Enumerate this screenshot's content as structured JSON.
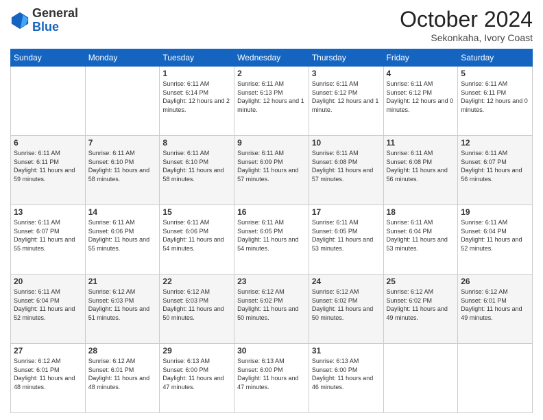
{
  "header": {
    "logo": {
      "line1": "General",
      "line2": "Blue"
    },
    "title": "October 2024",
    "subtitle": "Sekonkaha, Ivory Coast"
  },
  "days_of_week": [
    "Sunday",
    "Monday",
    "Tuesday",
    "Wednesday",
    "Thursday",
    "Friday",
    "Saturday"
  ],
  "weeks": [
    [
      {
        "day": "",
        "info": ""
      },
      {
        "day": "",
        "info": ""
      },
      {
        "day": "1",
        "sunrise": "Sunrise: 6:11 AM",
        "sunset": "Sunset: 6:14 PM",
        "daylight": "Daylight: 12 hours and 2 minutes."
      },
      {
        "day": "2",
        "sunrise": "Sunrise: 6:11 AM",
        "sunset": "Sunset: 6:13 PM",
        "daylight": "Daylight: 12 hours and 1 minute."
      },
      {
        "day": "3",
        "sunrise": "Sunrise: 6:11 AM",
        "sunset": "Sunset: 6:12 PM",
        "daylight": "Daylight: 12 hours and 1 minute."
      },
      {
        "day": "4",
        "sunrise": "Sunrise: 6:11 AM",
        "sunset": "Sunset: 6:12 PM",
        "daylight": "Daylight: 12 hours and 0 minutes."
      },
      {
        "day": "5",
        "sunrise": "Sunrise: 6:11 AM",
        "sunset": "Sunset: 6:11 PM",
        "daylight": "Daylight: 12 hours and 0 minutes."
      }
    ],
    [
      {
        "day": "6",
        "sunrise": "Sunrise: 6:11 AM",
        "sunset": "Sunset: 6:11 PM",
        "daylight": "Daylight: 11 hours and 59 minutes."
      },
      {
        "day": "7",
        "sunrise": "Sunrise: 6:11 AM",
        "sunset": "Sunset: 6:10 PM",
        "daylight": "Daylight: 11 hours and 58 minutes."
      },
      {
        "day": "8",
        "sunrise": "Sunrise: 6:11 AM",
        "sunset": "Sunset: 6:10 PM",
        "daylight": "Daylight: 11 hours and 58 minutes."
      },
      {
        "day": "9",
        "sunrise": "Sunrise: 6:11 AM",
        "sunset": "Sunset: 6:09 PM",
        "daylight": "Daylight: 11 hours and 57 minutes."
      },
      {
        "day": "10",
        "sunrise": "Sunrise: 6:11 AM",
        "sunset": "Sunset: 6:08 PM",
        "daylight": "Daylight: 11 hours and 57 minutes."
      },
      {
        "day": "11",
        "sunrise": "Sunrise: 6:11 AM",
        "sunset": "Sunset: 6:08 PM",
        "daylight": "Daylight: 11 hours and 56 minutes."
      },
      {
        "day": "12",
        "sunrise": "Sunrise: 6:11 AM",
        "sunset": "Sunset: 6:07 PM",
        "daylight": "Daylight: 11 hours and 56 minutes."
      }
    ],
    [
      {
        "day": "13",
        "sunrise": "Sunrise: 6:11 AM",
        "sunset": "Sunset: 6:07 PM",
        "daylight": "Daylight: 11 hours and 55 minutes."
      },
      {
        "day": "14",
        "sunrise": "Sunrise: 6:11 AM",
        "sunset": "Sunset: 6:06 PM",
        "daylight": "Daylight: 11 hours and 55 minutes."
      },
      {
        "day": "15",
        "sunrise": "Sunrise: 6:11 AM",
        "sunset": "Sunset: 6:06 PM",
        "daylight": "Daylight: 11 hours and 54 minutes."
      },
      {
        "day": "16",
        "sunrise": "Sunrise: 6:11 AM",
        "sunset": "Sunset: 6:05 PM",
        "daylight": "Daylight: 11 hours and 54 minutes."
      },
      {
        "day": "17",
        "sunrise": "Sunrise: 6:11 AM",
        "sunset": "Sunset: 6:05 PM",
        "daylight": "Daylight: 11 hours and 53 minutes."
      },
      {
        "day": "18",
        "sunrise": "Sunrise: 6:11 AM",
        "sunset": "Sunset: 6:04 PM",
        "daylight": "Daylight: 11 hours and 53 minutes."
      },
      {
        "day": "19",
        "sunrise": "Sunrise: 6:11 AM",
        "sunset": "Sunset: 6:04 PM",
        "daylight": "Daylight: 11 hours and 52 minutes."
      }
    ],
    [
      {
        "day": "20",
        "sunrise": "Sunrise: 6:11 AM",
        "sunset": "Sunset: 6:04 PM",
        "daylight": "Daylight: 11 hours and 52 minutes."
      },
      {
        "day": "21",
        "sunrise": "Sunrise: 6:12 AM",
        "sunset": "Sunset: 6:03 PM",
        "daylight": "Daylight: 11 hours and 51 minutes."
      },
      {
        "day": "22",
        "sunrise": "Sunrise: 6:12 AM",
        "sunset": "Sunset: 6:03 PM",
        "daylight": "Daylight: 11 hours and 50 minutes."
      },
      {
        "day": "23",
        "sunrise": "Sunrise: 6:12 AM",
        "sunset": "Sunset: 6:02 PM",
        "daylight": "Daylight: 11 hours and 50 minutes."
      },
      {
        "day": "24",
        "sunrise": "Sunrise: 6:12 AM",
        "sunset": "Sunset: 6:02 PM",
        "daylight": "Daylight: 11 hours and 50 minutes."
      },
      {
        "day": "25",
        "sunrise": "Sunrise: 6:12 AM",
        "sunset": "Sunset: 6:02 PM",
        "daylight": "Daylight: 11 hours and 49 minutes."
      },
      {
        "day": "26",
        "sunrise": "Sunrise: 6:12 AM",
        "sunset": "Sunset: 6:01 PM",
        "daylight": "Daylight: 11 hours and 49 minutes."
      }
    ],
    [
      {
        "day": "27",
        "sunrise": "Sunrise: 6:12 AM",
        "sunset": "Sunset: 6:01 PM",
        "daylight": "Daylight: 11 hours and 48 minutes."
      },
      {
        "day": "28",
        "sunrise": "Sunrise: 6:12 AM",
        "sunset": "Sunset: 6:01 PM",
        "daylight": "Daylight: 11 hours and 48 minutes."
      },
      {
        "day": "29",
        "sunrise": "Sunrise: 6:13 AM",
        "sunset": "Sunset: 6:00 PM",
        "daylight": "Daylight: 11 hours and 47 minutes."
      },
      {
        "day": "30",
        "sunrise": "Sunrise: 6:13 AM",
        "sunset": "Sunset: 6:00 PM",
        "daylight": "Daylight: 11 hours and 47 minutes."
      },
      {
        "day": "31",
        "sunrise": "Sunrise: 6:13 AM",
        "sunset": "Sunset: 6:00 PM",
        "daylight": "Daylight: 11 hours and 46 minutes."
      },
      {
        "day": "",
        "info": ""
      },
      {
        "day": "",
        "info": ""
      }
    ]
  ]
}
